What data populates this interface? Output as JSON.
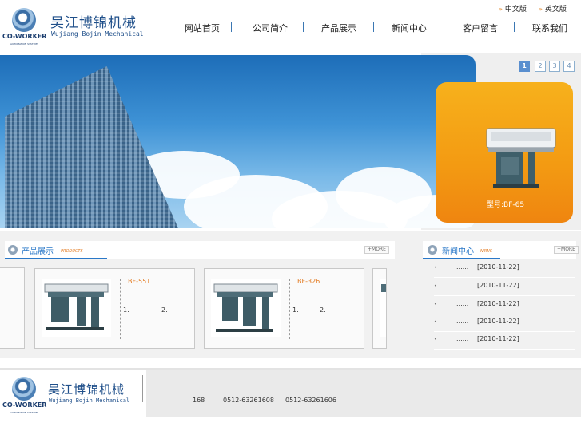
{
  "header": {
    "brand_cn": "吴江博锦机械",
    "brand_en": "Wujiang Bojin Mechanical",
    "logo_text": "CO-WORKER",
    "logo_subtext": "AUTOMATION SYSTEMS",
    "lang_cn": "中文版",
    "lang_en": "英文版"
  },
  "nav": [
    "网站首页",
    "公司简介",
    "产品展示",
    "新闻中心",
    "客户留言",
    "联系我们"
  ],
  "banner": {
    "pages": [
      "1",
      "2",
      "3",
      "4"
    ],
    "active_page": "1",
    "model_label": "型号:BF-65"
  },
  "products": {
    "title": "产品展示",
    "subtitle": "PRODUCTS",
    "more": "MORE",
    "items": [
      {
        "name": "BF-551",
        "line1": "1.",
        "line2": "2."
      },
      {
        "name": "BF-326",
        "line1": "1.",
        "line2": "2."
      }
    ]
  },
  "news": {
    "title": "新闻中心",
    "subtitle": "NEWS",
    "more": "MORE",
    "items": [
      {
        "bullet": "•",
        "title": "......",
        "date": "[2010-11-22]"
      },
      {
        "bullet": "•",
        "title": "......",
        "date": "[2010-11-22]"
      },
      {
        "bullet": "•",
        "title": "......",
        "date": "[2010-11-22]"
      },
      {
        "bullet": "•",
        "title": "......",
        "date": "[2010-11-22]"
      },
      {
        "bullet": "•",
        "title": "......",
        "date": "[2010-11-22]"
      }
    ]
  },
  "footer": {
    "brand_cn": "吴江博锦机械",
    "brand_en": "Wujiang Bojin Mechanical",
    "logo_text": "CO-WORKER",
    "logo_subtext": "AUTOMATION SYSTEMS",
    "address_num": "168",
    "phone1": "0512-63261608",
    "phone2": "0512-63261606"
  },
  "colors": {
    "accent": "#2a78c8",
    "orange": "#f39a12",
    "nav_sep": "#3b77b3"
  }
}
